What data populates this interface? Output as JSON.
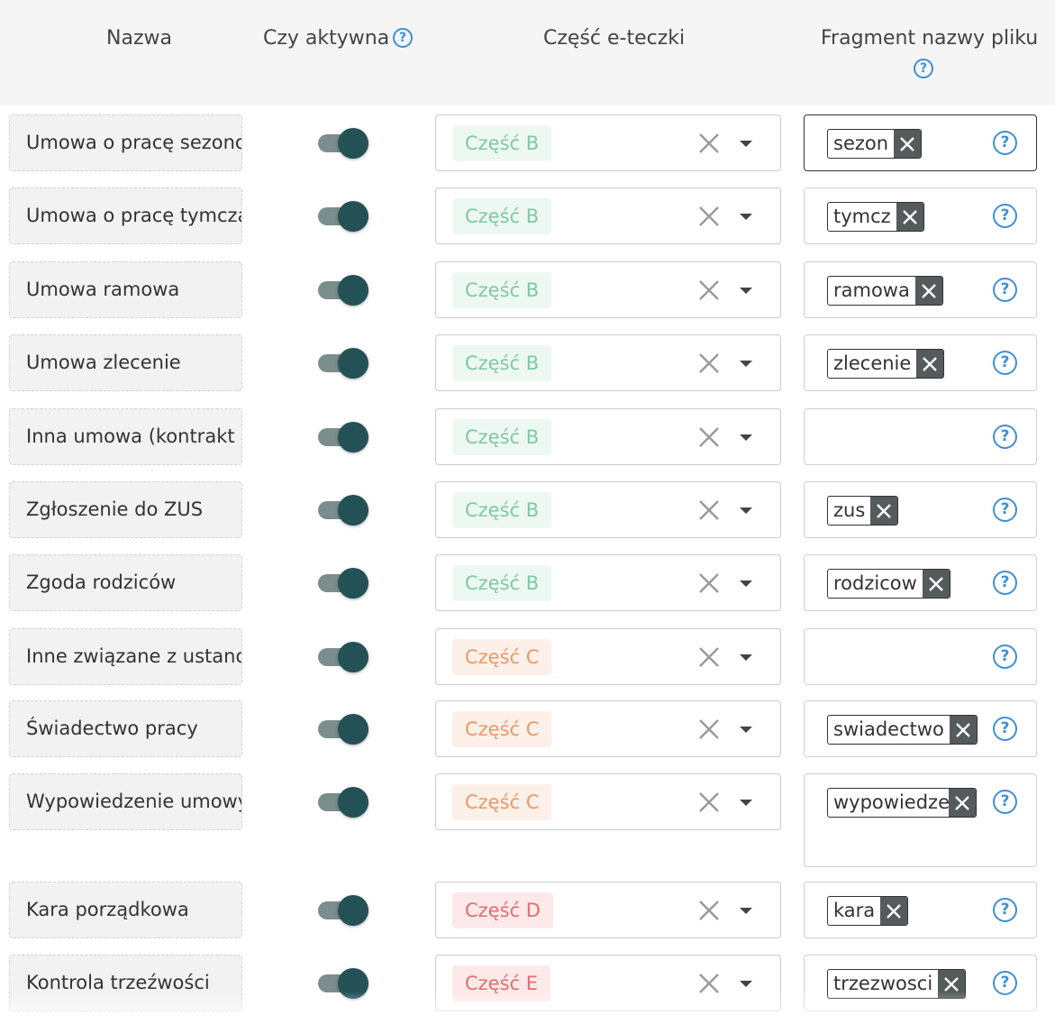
{
  "header": {
    "name": "Nazwa",
    "active": "Czy aktywna",
    "part": "Część e-teczki",
    "fragment": "Fragment nazwy pliku",
    "help": "?"
  },
  "rows": [
    {
      "name": "Umowa o pracę sezonowa",
      "active": true,
      "part": "Część B",
      "tag": "sezon"
    },
    {
      "name": "Umowa o pracę tymczasowa",
      "active": true,
      "part": "Część B",
      "tag": "tymcz"
    },
    {
      "name": "Umowa ramowa",
      "active": true,
      "part": "Część B",
      "tag": "ramowa"
    },
    {
      "name": "Umowa zlecenie",
      "active": true,
      "part": "Część B",
      "tag": "zlecenie"
    },
    {
      "name": "Inna umowa (kontrakt",
      "active": true,
      "part": "Część B",
      "tag": ""
    },
    {
      "name": "Zgłoszenie do ZUS",
      "active": true,
      "part": "Część B",
      "tag": "zus"
    },
    {
      "name": "Zgoda rodziców",
      "active": true,
      "part": "Część B",
      "tag": "rodzicow"
    },
    {
      "name": "Inne związane z ustanowieniem",
      "active": true,
      "part": "Część C",
      "tag": ""
    },
    {
      "name": "Świadectwo pracy",
      "active": true,
      "part": "Część C",
      "tag": "swiadectwo"
    },
    {
      "name": "Wypowiedzenie umowy",
      "active": true,
      "part": "Część C",
      "tag": "wypowiedzenie"
    },
    {
      "name": "Kara porządkowa",
      "active": true,
      "part": "Część D",
      "tag": "kara"
    },
    {
      "name": "Kontrola trzeźwości",
      "active": true,
      "part": "Część E",
      "tag": "trzezwosci"
    }
  ],
  "colors": {
    "part_b": "#7ec9a4",
    "part_c": "#e79a6a",
    "part_de": "#e06f6f",
    "toggle_knob": "#235156",
    "help": "#3d8fd9"
  },
  "icons": {
    "clear": "x-icon",
    "dropdown": "chevron-down-icon",
    "help": "question-circle-icon",
    "tag_remove": "x-icon"
  }
}
